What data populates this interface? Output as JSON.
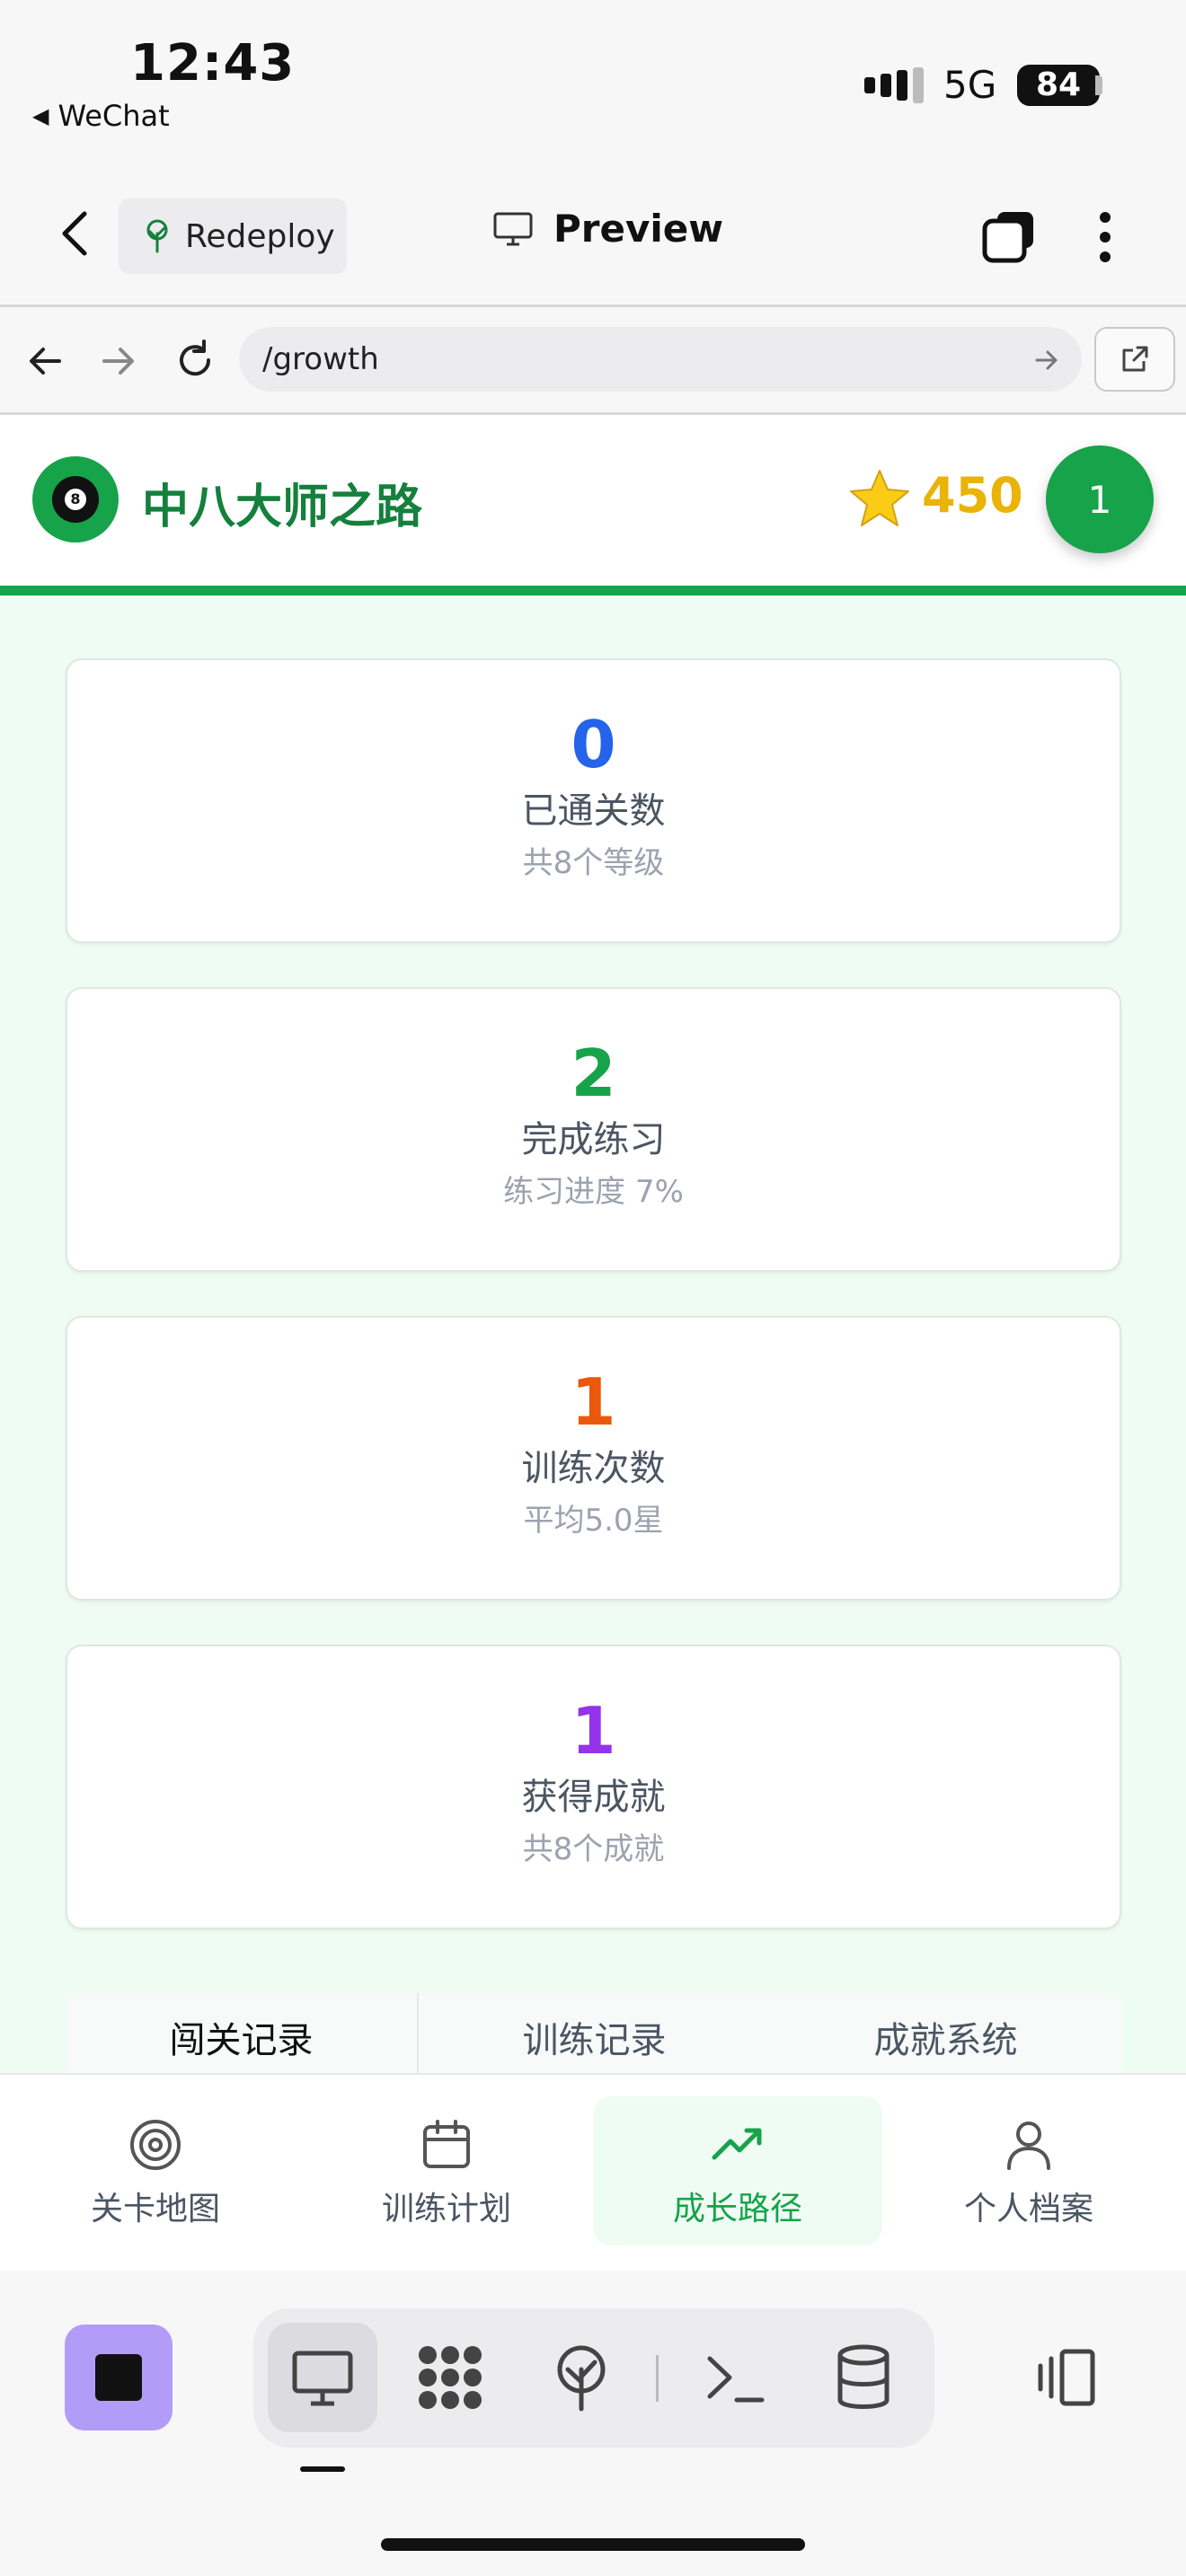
{
  "status_bar": {
    "time": "12:43",
    "back_app": "WeChat",
    "network": "5G",
    "battery": "84"
  },
  "toolbar": {
    "redeploy_label": "Redeploy",
    "preview_label": "Preview"
  },
  "address_bar": {
    "url": "/growth"
  },
  "app_header": {
    "title": "中八大师之路",
    "logo_ball_number": "8",
    "points": "450",
    "level": "1"
  },
  "stats": [
    {
      "value": "0",
      "label": "已通关数",
      "sub": "共8个等级",
      "color": "#2563eb"
    },
    {
      "value": "2",
      "label": "完成练习",
      "sub": "练习进度 7%",
      "color": "#16a34a"
    },
    {
      "value": "1",
      "label": "训练次数",
      "sub": "平均5.0星",
      "color": "#ea580c"
    },
    {
      "value": "1",
      "label": "获得成就",
      "sub": "共8个成就",
      "color": "#9333ea"
    }
  ],
  "records_tabs": [
    "闯关记录",
    "训练记录",
    "成就系统"
  ],
  "bottom_nav": [
    {
      "label": "关卡地图",
      "icon": "target-icon"
    },
    {
      "label": "训练计划",
      "icon": "calendar-icon"
    },
    {
      "label": "成长路径",
      "icon": "trending-up-icon",
      "active": true
    },
    {
      "label": "个人档案",
      "icon": "user-icon"
    }
  ],
  "colors": {
    "brand_green": "#16a34a",
    "title_green": "#15803d",
    "star_yellow": "#eab308",
    "content_bg": "#effcf3",
    "stop_purple": "#b39cf7"
  }
}
